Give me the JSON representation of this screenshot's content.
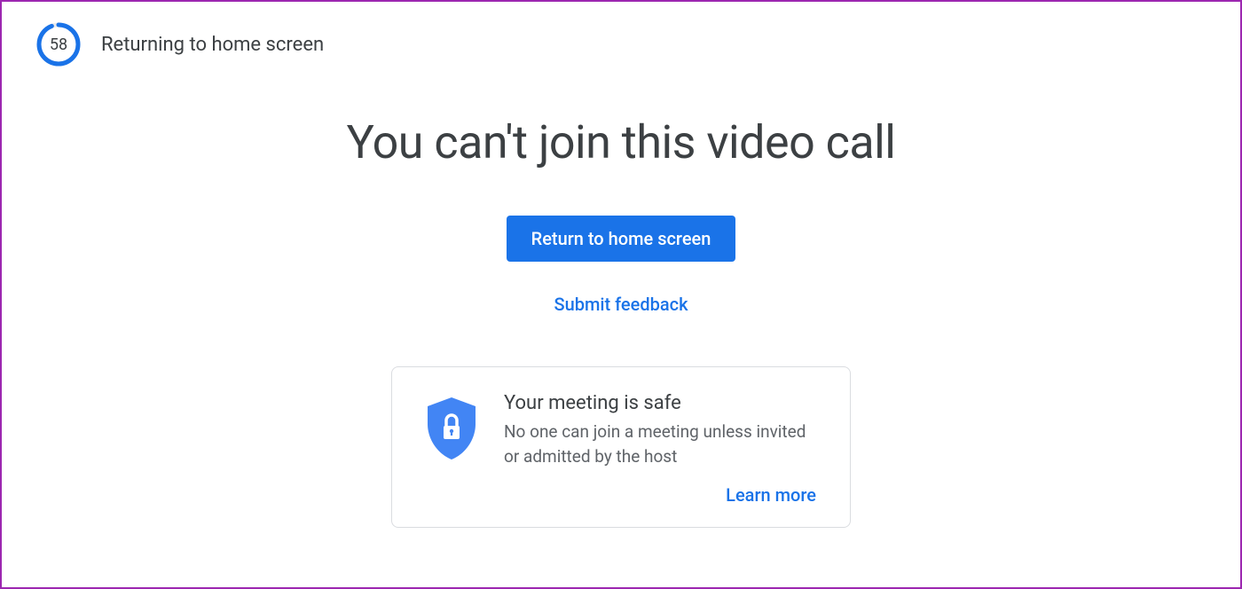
{
  "countdown": {
    "value": "58",
    "text": "Returning to home screen"
  },
  "main": {
    "heading": "You can't join this video call",
    "return_button": "Return to home screen",
    "feedback_link": "Submit feedback"
  },
  "info_card": {
    "title": "Your meeting is safe",
    "description": "No one can join a meeting unless invited or admitted by the host",
    "learn_more": "Learn more"
  },
  "colors": {
    "primary": "#1a73e8",
    "text_primary": "#3c4043",
    "text_secondary": "#5f6368",
    "shield": "#4285f4"
  }
}
